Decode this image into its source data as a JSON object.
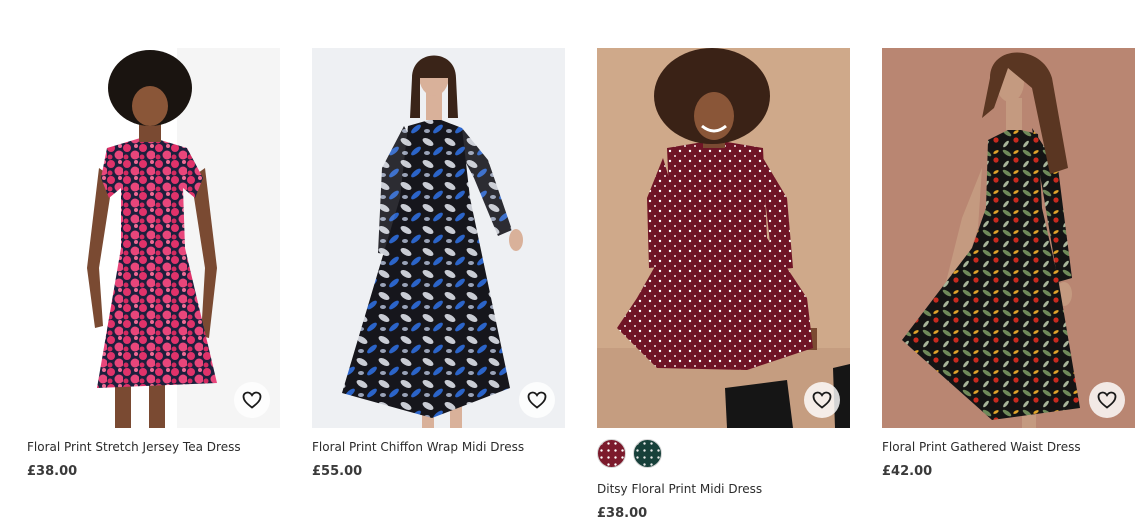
{
  "products": [
    {
      "name": "Floral Print Stretch Jersey Tea Dress",
      "price": "£38.00",
      "image_icon": "model-pink-floral-tea-dress",
      "wishlist_icon": "heart-outline-icon"
    },
    {
      "name": "Floral Print Chiffon Wrap Midi Dress",
      "price": "£55.00",
      "image_icon": "model-blue-floral-chiffon-dress",
      "wishlist_icon": "heart-outline-icon"
    },
    {
      "name": "Ditsy Floral Print Midi Dress",
      "price": "£38.00",
      "image_icon": "model-burgundy-polka-dress",
      "wishlist_icon": "heart-outline-icon",
      "swatches": [
        {
          "color": "#7c1a2c"
        },
        {
          "color": "#17403a"
        }
      ]
    },
    {
      "name": "Floral Print Gathered Waist Dress",
      "price": "£42.00",
      "image_icon": "model-black-floral-gathered-dress",
      "wishlist_icon": "heart-outline-icon"
    }
  ],
  "colors": {
    "text": "#2b2b2b",
    "price": "#3a3a3a",
    "background": "#ffffff"
  }
}
